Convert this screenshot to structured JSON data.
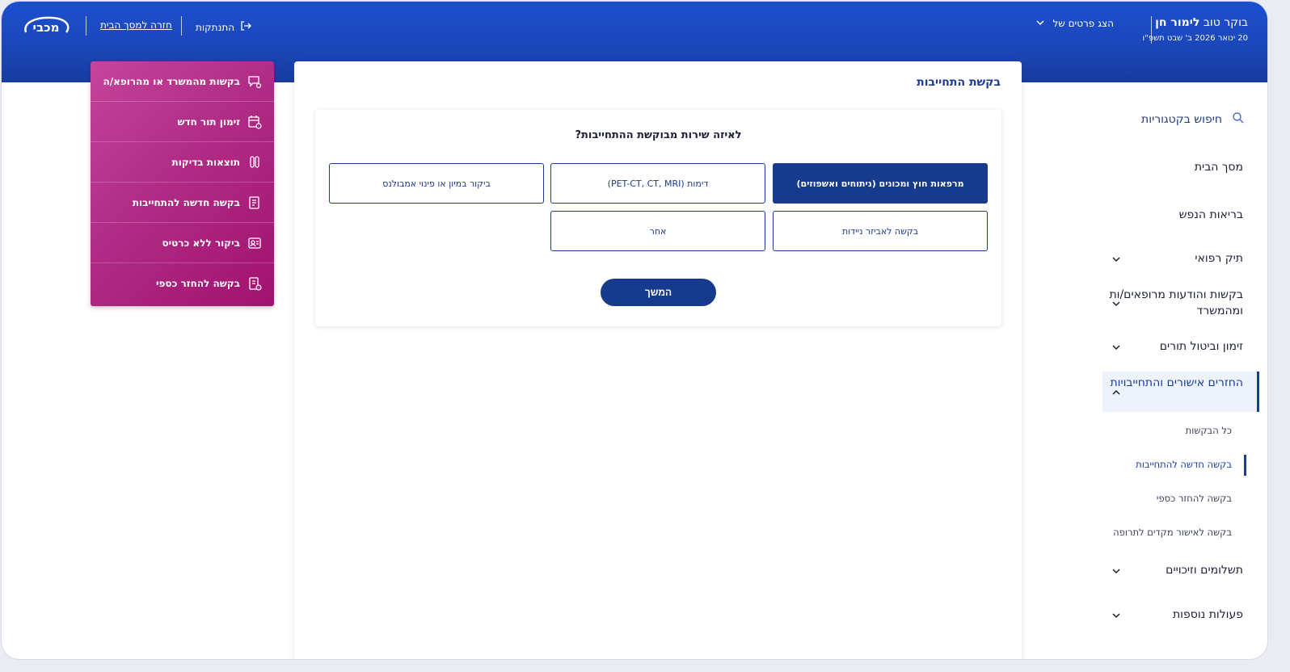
{
  "header": {
    "greeting_prefix": "בוקר טוב",
    "user_name": "לימור חן",
    "date_line": "20 ינואר 2026 ב' שבט תשפ\"ו",
    "show_details_label": "הצג פרטים של",
    "logout_label": "התנתקות",
    "back_home_label": "חזרה למסך הבית",
    "brand_name": "מכבי"
  },
  "quick_actions": [
    {
      "label": "בקשות מהמשרד או מהרופא/ה",
      "icon": "chat-doctor-icon"
    },
    {
      "label": "זימון תור חדש",
      "icon": "calendar-add-icon"
    },
    {
      "label": "תוצאות בדיקות",
      "icon": "test-tubes-icon"
    },
    {
      "label": "בקשה חדשה להתחייבות",
      "icon": "document-new-icon"
    },
    {
      "label": "ביקור ללא כרטיס",
      "icon": "id-card-icon"
    },
    {
      "label": "בקשה להחזר כספי",
      "icon": "document-refund-icon"
    }
  ],
  "main": {
    "title": "בקשת התחייבות",
    "question": "לאיזה שירות מבוקשת ההתחייבות?",
    "options": [
      {
        "label": "מרפאות חוץ ומכונים (ניתוחים ואשפוזים)",
        "selected": true
      },
      {
        "label": "דימות (PET-CT, CT, MRI)",
        "selected": false
      },
      {
        "label": "ביקור במיון או פינוי אמבולנס",
        "selected": false
      },
      {
        "label": "בקשה לאביזר ניידות",
        "selected": false
      },
      {
        "label": "אחר",
        "selected": false
      }
    ],
    "continue_label": "המשך"
  },
  "sidebar": {
    "search_label": "חיפוש בקטגוריות",
    "items": [
      {
        "label": "מסך הבית"
      },
      {
        "label": "בריאות הנפש"
      },
      {
        "label": "תיק רפואי"
      },
      {
        "label": "בקשות והודעות מרופאים/ות ומהמשרד"
      },
      {
        "label": "זימון וביטול תורים"
      },
      {
        "label": "החזרים אישורים והתחייבויות"
      },
      {
        "label": "תשלומים וזיכויים"
      },
      {
        "label": "פעולות נוספות"
      }
    ],
    "sub_items": [
      {
        "label": "כל הבקשות"
      },
      {
        "label": "בקשה חדשה להתחייבות"
      },
      {
        "label": "בקשה להחזר כספי"
      },
      {
        "label": "בקשה לאישור מקדים לתרופה"
      }
    ]
  },
  "colors": {
    "header_blue": "#1c4fcf",
    "primary_navy": "#163a8c",
    "quick_panel_magenta": "#b02c86"
  }
}
